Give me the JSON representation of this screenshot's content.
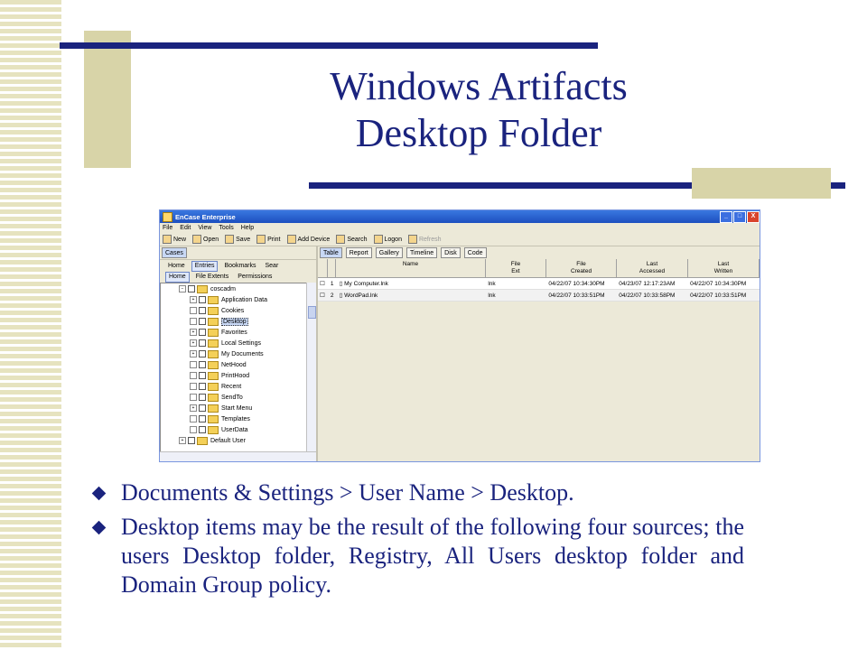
{
  "slide": {
    "title_line1": "Windows Artifacts",
    "title_line2": "Desktop Folder",
    "bullets": [
      "Documents & Settings > User Name > Desktop.",
      "Desktop items may be the result of the following four sources; the users Desktop folder, Registry, All Users desktop folder and Domain Group policy."
    ],
    "colors": {
      "title": "#1a237e",
      "accent_line": "#1a237e",
      "tan": "#d8d4a8"
    }
  },
  "app": {
    "title": "EnCase Enterprise",
    "window_controls": [
      "_",
      "□",
      "X"
    ],
    "menu": [
      "File",
      "Edit",
      "View",
      "Tools",
      "Help"
    ],
    "toolbar": [
      {
        "label": "New",
        "icon": "new-icon"
      },
      {
        "label": "Open",
        "icon": "open-icon"
      },
      {
        "label": "Save",
        "icon": "save-icon"
      },
      {
        "label": "Print",
        "icon": "print-icon"
      },
      {
        "label": "Add Device",
        "icon": "add-device-icon"
      },
      {
        "label": "Search",
        "icon": "search-icon"
      },
      {
        "label": "Logon",
        "icon": "logon-icon"
      },
      {
        "label": "Refresh",
        "icon": "refresh-icon",
        "disabled": true
      }
    ],
    "left": {
      "cases_tab": "Cases",
      "tabs_row1": [
        "Home",
        "Entries",
        "Bookmarks",
        "Sear"
      ],
      "tabs_row2": [
        "Home",
        "File Extents",
        "Permissions"
      ],
      "tree": [
        {
          "label": "coscadm",
          "indent": 0,
          "expander": "−"
        },
        {
          "label": "Application Data",
          "indent": 1,
          "expander": "+"
        },
        {
          "label": "Cookies",
          "indent": 1,
          "expander": ""
        },
        {
          "label": "Desktop",
          "indent": 1,
          "expander": "",
          "selected": true
        },
        {
          "label": "Favorites",
          "indent": 1,
          "expander": "+"
        },
        {
          "label": "Local Settings",
          "indent": 1,
          "expander": "+"
        },
        {
          "label": "My Documents",
          "indent": 1,
          "expander": "+"
        },
        {
          "label": "NetHood",
          "indent": 1,
          "expander": ""
        },
        {
          "label": "PrintHood",
          "indent": 1,
          "expander": ""
        },
        {
          "label": "Recent",
          "indent": 1,
          "expander": ""
        },
        {
          "label": "SendTo",
          "indent": 1,
          "expander": ""
        },
        {
          "label": "Start Menu",
          "indent": 1,
          "expander": "+"
        },
        {
          "label": "Templates",
          "indent": 1,
          "expander": ""
        },
        {
          "label": "UserData",
          "indent": 1,
          "expander": ""
        },
        {
          "label": "Default User",
          "indent": 0,
          "expander": "+"
        }
      ]
    },
    "right": {
      "view_tabs": [
        "Table",
        "Report",
        "Gallery",
        "Timeline",
        "Disk",
        "Code"
      ],
      "columns": [
        "",
        "Name",
        "File\nExt",
        "File\nCreated",
        "Last\nAccessed",
        "Last\nWritten"
      ],
      "rows": [
        {
          "num": "1",
          "name": "My Computer.lnk",
          "ext": "lnk",
          "created": "04/22/07 10:34:30PM",
          "accessed": "04/23/07 12:17:23AM",
          "written": "04/22/07 10:34:30PM"
        },
        {
          "num": "2",
          "name": "WordPad.lnk",
          "ext": "lnk",
          "created": "04/22/07 10:33:51PM",
          "accessed": "04/22/07 10:33:58PM",
          "written": "04/22/07 10:33:51PM"
        }
      ]
    }
  }
}
